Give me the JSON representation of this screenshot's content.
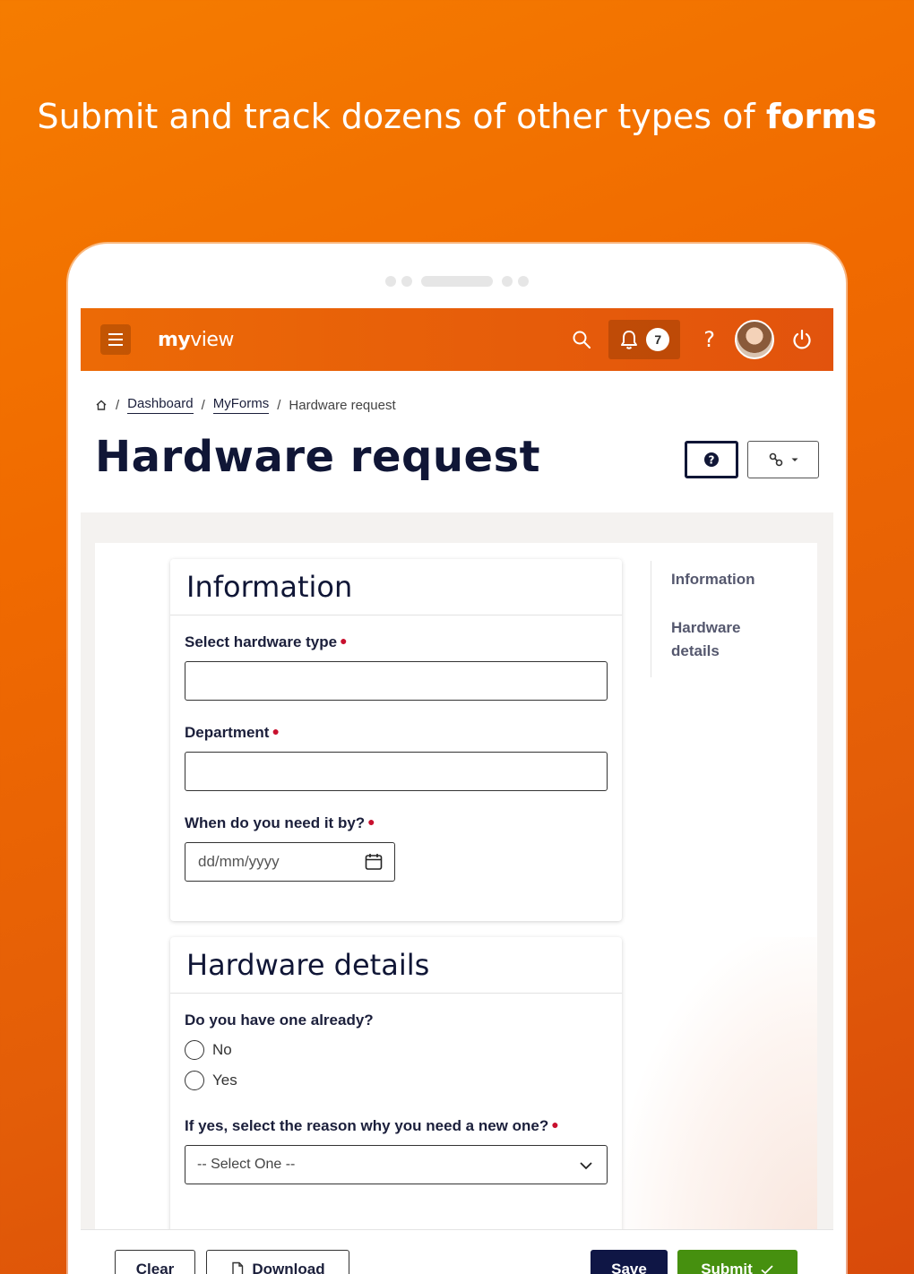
{
  "promo": {
    "headline_main": "Submit and track dozens of other types of",
    "headline_bold": "forms"
  },
  "topbar": {
    "logo_bold": "my",
    "logo_rest": "view",
    "notification_count": "7",
    "help_symbol": "?"
  },
  "breadcrumb": {
    "home_icon": "home-icon",
    "items": [
      "Dashboard",
      "MyForms",
      "Hardware request"
    ],
    "separator": "/"
  },
  "page": {
    "title": "Hardware request"
  },
  "sections": {
    "information": {
      "title": "Information",
      "hardware_type_label": "Select hardware type",
      "hardware_type_value": "",
      "department_label": "Department",
      "department_value": "",
      "need_by_label": "When do you need it by?",
      "need_by_placeholder": "dd/mm/yyyy"
    },
    "hardware_details": {
      "title": "Hardware details",
      "have_one_label": "Do you have one already?",
      "options": [
        "No",
        "Yes"
      ],
      "reason_label": "If yes, select the reason why you need a new one?",
      "reason_selected": "-- Select One --"
    }
  },
  "toc": {
    "items": [
      "Information",
      "Hardware details"
    ]
  },
  "footer": {
    "clear_label": "Clear",
    "download_label": "Download",
    "save_label": "Save",
    "submit_label": "Submit"
  },
  "colors": {
    "brand_orange": "#ec6a06",
    "navy": "#0f1645",
    "submit_green": "#46900f",
    "required_red": "#c8102e"
  }
}
